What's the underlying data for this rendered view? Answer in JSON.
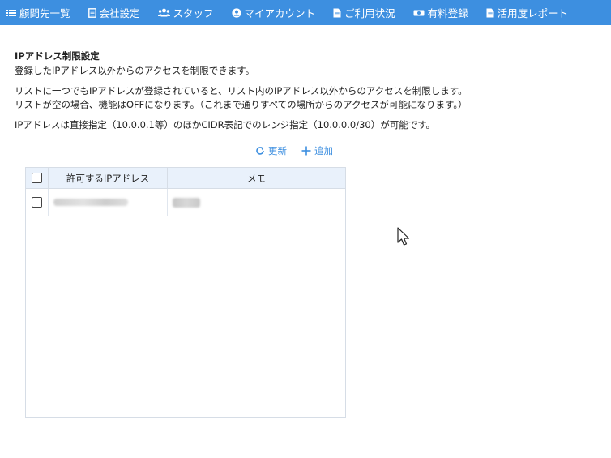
{
  "nav": {
    "items": [
      {
        "label": "顧問先一覧",
        "icon": "list-icon"
      },
      {
        "label": "会社設定",
        "icon": "document-icon"
      },
      {
        "label": "スタッフ",
        "icon": "users-icon"
      },
      {
        "label": "マイアカウント",
        "icon": "user-circle-icon"
      },
      {
        "label": "ご利用状況",
        "icon": "file-icon"
      },
      {
        "label": "有料登録",
        "icon": "money-icon"
      },
      {
        "label": "活用度レポート",
        "icon": "file-icon"
      }
    ]
  },
  "page": {
    "title": "IPアドレス制限設定",
    "subtitle": "登録したIPアドレス以外からのアクセスを制限できます。",
    "desc1": "リストに一つでもIPアドレスが登録されていると、リスト内のIPアドレス以外からのアクセスを制限します。",
    "desc2": "リストが空の場合、機能はOFFになります。（これまで通りすべての場所からのアクセスが可能になります。）",
    "desc3": "IPアドレスは直接指定（10.0.0.1等）のほかCIDR表記でのレンジ指定（10.0.0.0/30）が可能です。"
  },
  "actions": {
    "refresh": "更新",
    "add": "追加"
  },
  "table": {
    "columns": {
      "ip": "許可するIPアドレス",
      "memo": "メモ"
    },
    "rows": [
      {
        "ip": "",
        "memo": ""
      }
    ]
  },
  "colors": {
    "nav_bg": "#3d8fe0",
    "accent": "#3d8fe0",
    "header_bg": "#e9f1fb"
  }
}
